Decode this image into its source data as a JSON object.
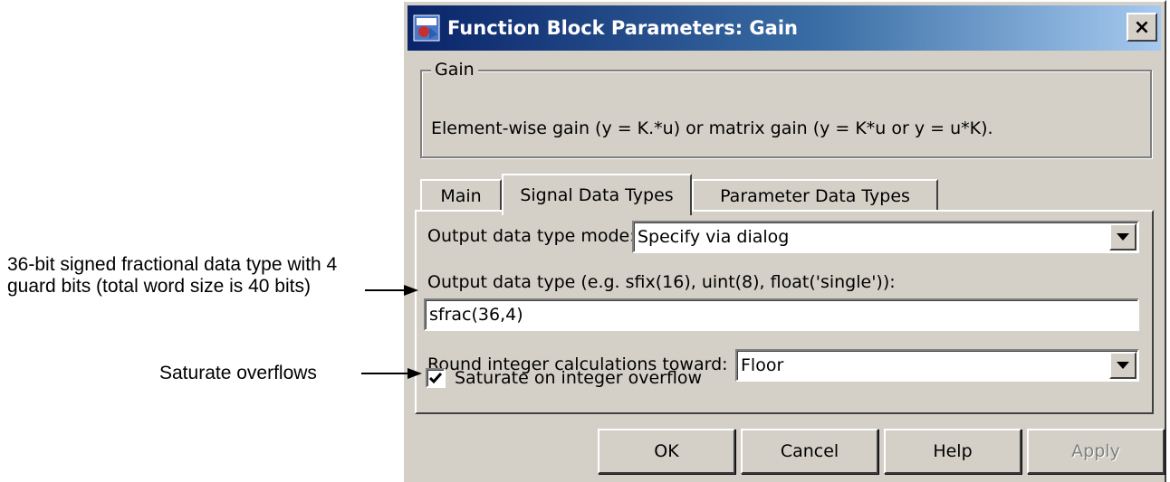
{
  "annotations": {
    "data_type_note": "36-bit signed fractional data type with 4 guard bits (total word size is 40 bits)",
    "saturate_note": "Saturate overflows"
  },
  "dialog": {
    "title": "Function Block Parameters: Gain",
    "close_label": "×",
    "group": {
      "legend": "Gain",
      "description": "Element-wise gain (y = K.*u) or matrix gain (y = K*u or y = u*K)."
    },
    "tabs": [
      {
        "label": "Main",
        "active": false
      },
      {
        "label": "Signal Data Types",
        "active": true
      },
      {
        "label": "Parameter Data Types",
        "active": false
      }
    ],
    "fields": {
      "output_mode_label": "Output data type mode:",
      "output_mode_value": "Specify via dialog",
      "output_type_label": "Output data type (e.g. sfix(16), uint(8), float('single')):",
      "output_type_value": "sfrac(36,4)",
      "round_label": "Round integer calculations toward:",
      "round_value": "Floor",
      "saturate_label": "Saturate on integer overflow",
      "saturate_checked": true
    },
    "buttons": {
      "ok": "OK",
      "cancel": "Cancel",
      "help": "Help",
      "apply": "Apply"
    }
  }
}
